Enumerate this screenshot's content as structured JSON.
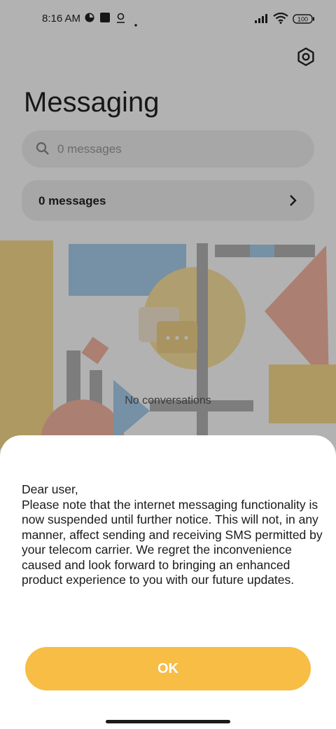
{
  "status_bar": {
    "time": "8:16 AM",
    "battery": "100"
  },
  "header": {
    "title": "Messaging"
  },
  "search": {
    "placeholder": "0 messages"
  },
  "summary_row": {
    "label": "0 messages"
  },
  "empty_state": {
    "text": "No conversations"
  },
  "dialog": {
    "greeting": "Dear user,",
    "body": "Please note that the internet messaging functionality is now suspended until further notice. This will not, in any manner, affect sending and receiving SMS permitted by your telecom carrier. We regret the inconvenience caused and look forward to bringing an enhanced product experience to you with our future updates.",
    "ok_label": "OK"
  },
  "colors": {
    "accent": "#f7bd45",
    "scrim": "rgba(0,0,0,0.30)"
  },
  "icons": [
    "settings-icon",
    "search-icon",
    "chevron-right-icon",
    "wifi-icon",
    "signal-icon",
    "battery-icon"
  ]
}
